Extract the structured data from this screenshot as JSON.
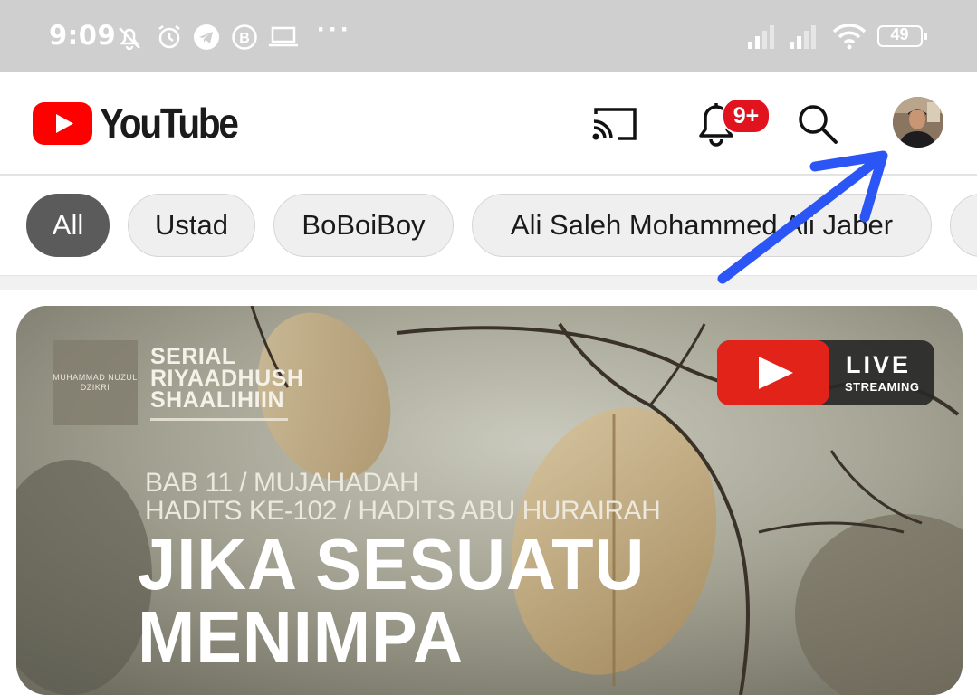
{
  "status_bar": {
    "time": "9:09",
    "battery": "49",
    "icons": [
      "mute-bell-icon",
      "alarm-icon",
      "telegram-icon",
      "bbm-icon",
      "laptop-icon",
      "more-dots-icon",
      "signal-icon",
      "signal-icon",
      "wifi-icon",
      "battery-icon"
    ]
  },
  "header": {
    "logo_text": "YouTube",
    "notification_badge": "9+",
    "icons": [
      "cast-icon",
      "bell-icon",
      "search-icon",
      "avatar"
    ]
  },
  "chips": [
    {
      "label": "All",
      "active": true
    },
    {
      "label": "Ustad",
      "active": false
    },
    {
      "label": "BoBoiBoy",
      "active": false
    },
    {
      "label": "Ali Saleh Mohammed Ali Jaber",
      "active": false
    }
  ],
  "video": {
    "channel_box": "MUHAMMAD NUZUL DZIKRI",
    "series_line1": "SERIAL",
    "series_line2": "RIYAADHUSH",
    "series_line3": "SHAALIHIIN",
    "live_label": "LIVE",
    "live_sub": "STREAMING",
    "bab_line1": "BAB 11 / MUJAHADAH",
    "bab_line2": "HADITS KE-102 / HADITS ABU HURAIRAH",
    "title_line1": "JIKA SESUATU",
    "title_line2": "MENIMPA"
  },
  "colors": {
    "brand_red": "#ff0000",
    "badge_red": "#e0131e",
    "annotation_arrow": "#2b56f5",
    "status_bar_bg": "#cfcfcf"
  }
}
